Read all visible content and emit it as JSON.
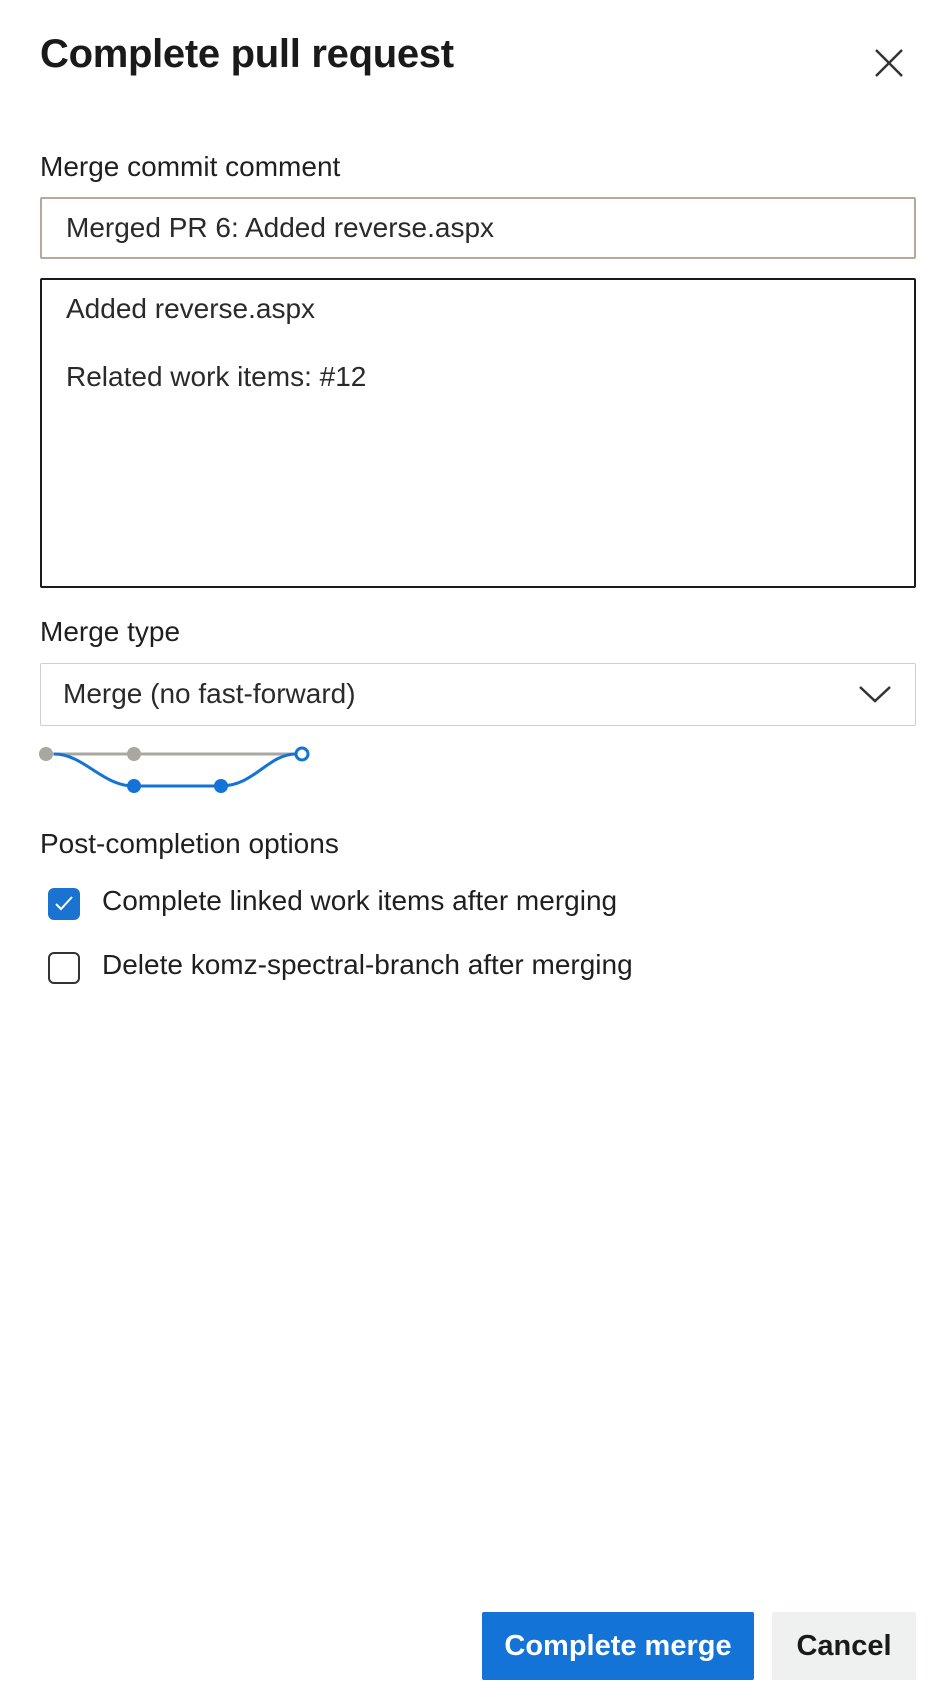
{
  "dialog": {
    "title": "Complete pull request",
    "close_icon": "close-icon"
  },
  "merge_commit": {
    "label": "Merge commit comment",
    "title_value": "Merged PR 6: Added reverse.aspx",
    "description_lines": [
      "Added reverse.aspx",
      "Related work items: #12"
    ]
  },
  "merge_type": {
    "label": "Merge type",
    "selected": "Merge (no fast-forward)",
    "chevron_icon": "chevron-down-icon",
    "diagram_icon": "merge-graph-icon"
  },
  "post_completion": {
    "label": "Post-completion options",
    "options": [
      {
        "label": "Complete linked work items after merging",
        "checked": true
      },
      {
        "label": "Delete komz-spectral-branch after merging",
        "checked": false
      }
    ]
  },
  "actions": {
    "primary_label": "Complete merge",
    "secondary_label": "Cancel"
  },
  "colors": {
    "accent": "#1373d6",
    "branch_gray": "#a8a8a0",
    "cancel_bg": "#eef1ef"
  }
}
